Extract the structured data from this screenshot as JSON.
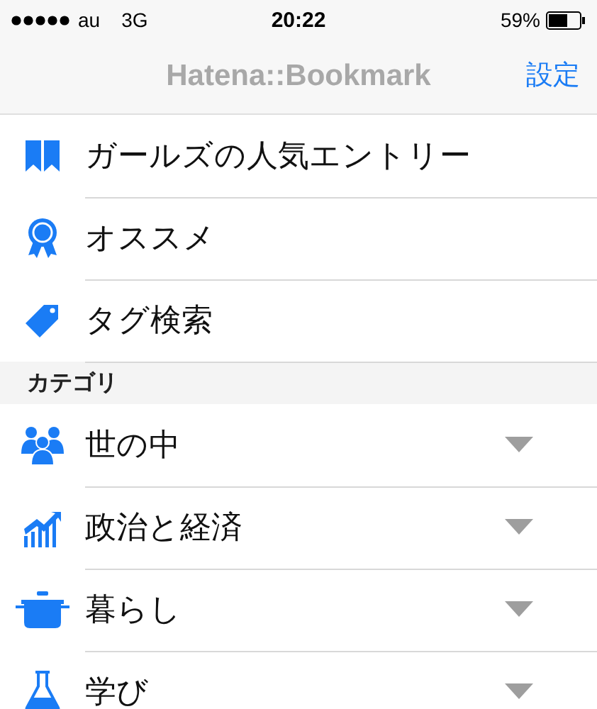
{
  "status_bar": {
    "carrier": "au",
    "network": "3G",
    "time": "20:22",
    "battery": "59%"
  },
  "nav_bar": {
    "title": "Hatena::Bookmark",
    "action": "設定"
  },
  "menu_items": [
    {
      "label": "ガールズの人気エントリー"
    },
    {
      "label": "オススメ"
    },
    {
      "label": "タグ検索"
    }
  ],
  "category_section": {
    "title": "カテゴリ",
    "items": [
      {
        "label": "世の中"
      },
      {
        "label": "政治と経済"
      },
      {
        "label": "暮らし"
      },
      {
        "label": "学び"
      }
    ]
  }
}
